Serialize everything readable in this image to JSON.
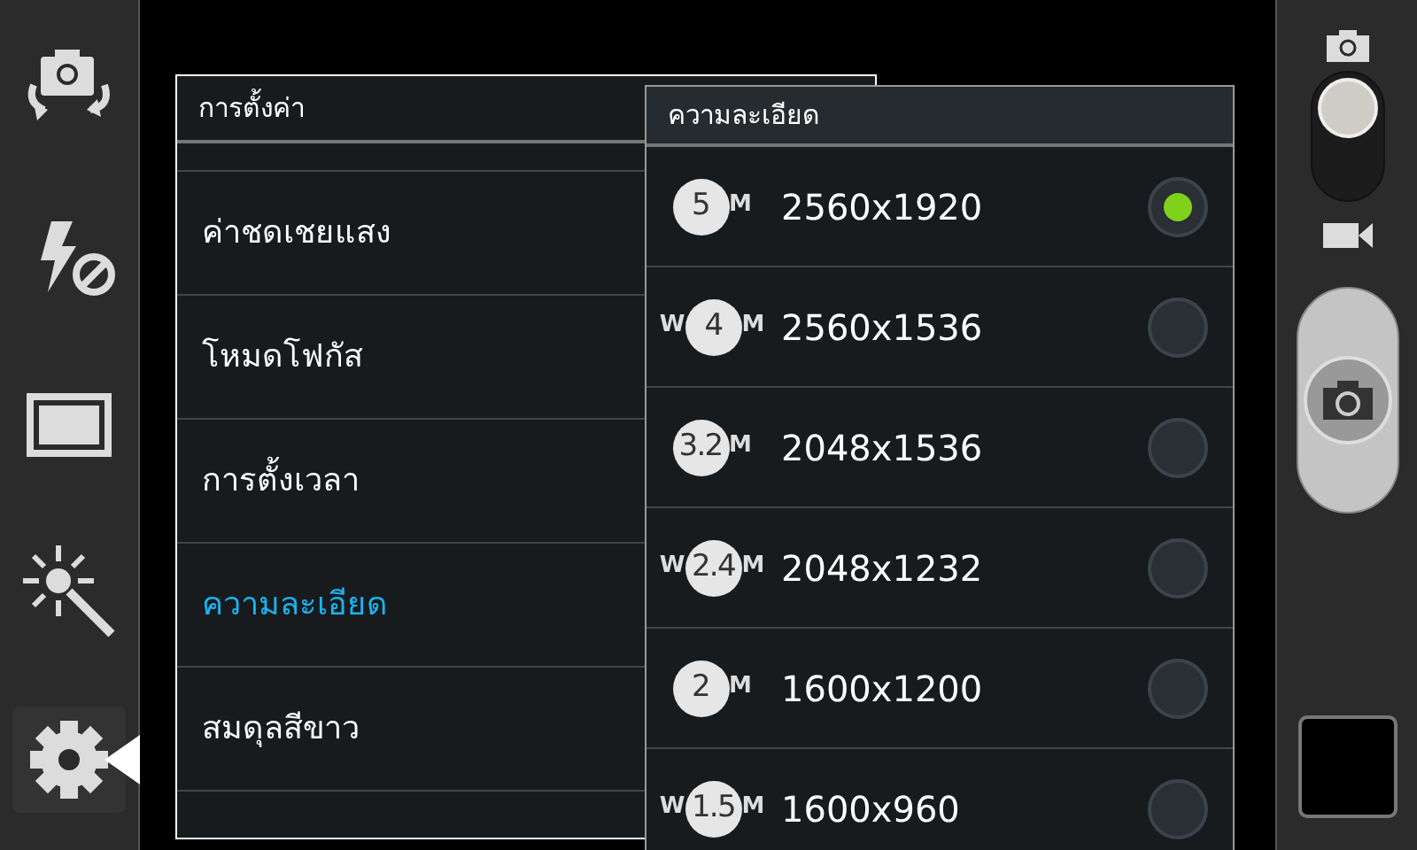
{
  "sidebar": {
    "items": [
      {
        "kind": "camera-switch",
        "selected": false
      },
      {
        "kind": "flash-off",
        "selected": false
      },
      {
        "kind": "frame",
        "selected": false
      },
      {
        "kind": "effects",
        "selected": false
      },
      {
        "kind": "settings",
        "selected": true
      }
    ]
  },
  "settings_menu": {
    "title": "การตั้งค่า",
    "items": [
      {
        "label": "ค่าชดเชยแสง",
        "selected": false
      },
      {
        "label": "โหมดโฟกัส",
        "selected": false
      },
      {
        "label": "การตั้งเวลา",
        "selected": false
      },
      {
        "label": "ความละเอียด",
        "selected": true
      },
      {
        "label": "สมดุลสีขาว",
        "selected": false
      }
    ]
  },
  "resolution_menu": {
    "title": "ความละเอียด",
    "options": [
      {
        "number": "5",
        "unit": "M",
        "label": "2560x1920",
        "selected": true
      },
      {
        "prefix": "W",
        "number": "4",
        "unit": "M",
        "label": "2560x1536",
        "selected": false
      },
      {
        "number": "3.2",
        "unit": "M",
        "label": "2048x1536",
        "selected": false
      },
      {
        "prefix": "W",
        "number": "2.4",
        "unit": "M",
        "label": "2048x1232",
        "selected": false
      },
      {
        "number": "2",
        "unit": "M",
        "label": "1600x1200",
        "selected": false
      },
      {
        "prefix": "W",
        "number": "1.5",
        "unit": "M",
        "label": "1600x960",
        "selected": false
      }
    ]
  },
  "camera_mode": {
    "photo_selected": true
  }
}
